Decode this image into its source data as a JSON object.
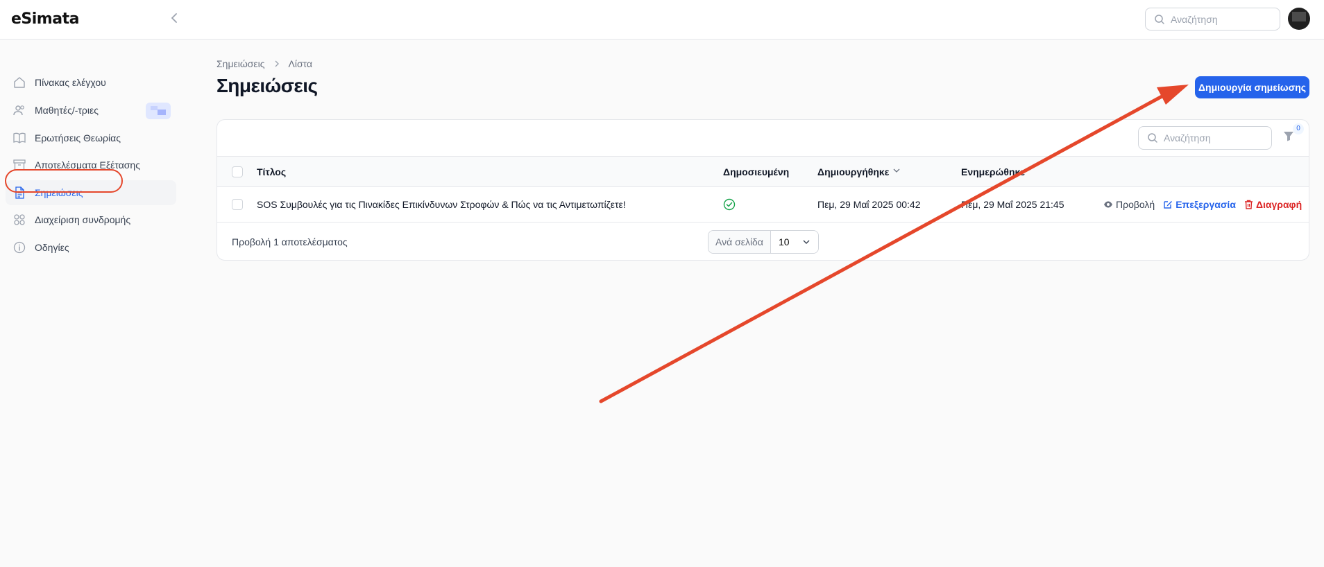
{
  "app": {
    "logo_text": "eSimata"
  },
  "topbar": {
    "search_placeholder": "Αναζήτηση"
  },
  "sidebar": {
    "items": [
      {
        "label": "Πίνακας ελέγχου",
        "icon": "home-icon"
      },
      {
        "label": "Μαθητές/-τριες",
        "icon": "users-icon"
      },
      {
        "label": "Ερωτήσεις Θεωρίας",
        "icon": "book-icon"
      },
      {
        "label": "Αποτελέσματα Εξέτασης",
        "icon": "archive-icon"
      },
      {
        "label": "Σημειώσεις",
        "icon": "document-icon",
        "active": true
      },
      {
        "label": "Διαχείριση συνδρομής",
        "icon": "grid-icon"
      },
      {
        "label": "Οδηγίες",
        "icon": "info-icon"
      }
    ]
  },
  "breadcrumb": {
    "items": [
      "Σημειώσεις",
      "Λίστα"
    ]
  },
  "page": {
    "title": "Σημειώσεις",
    "create_button": "Δημιουργία σημείωσης"
  },
  "table": {
    "search_placeholder": "Αναζήτηση",
    "filter_count": "0",
    "columns": [
      "Τίτλος",
      "Δημοσιευμένη",
      "Δημιουργήθηκε",
      "Ενημερώθηκε"
    ],
    "rows": [
      {
        "title": "SOS Συμβουλές για τις Πινακίδες Επικίνδυνων Στροφών & Πώς να τις Αντιμετωπίζετε!",
        "published": true,
        "created": "Πεμ, 29 Μαΐ 2025 00:42",
        "updated": "Πεμ, 29 Μαΐ 2025 21:45"
      }
    ],
    "actions": {
      "view": "Προβολή",
      "edit": "Επεξεργασία",
      "delete": "Διαγραφή"
    },
    "footer": {
      "results": "Προβολή 1 αποτελέσματος",
      "per_page_label": "Ανά σελίδα",
      "per_page_value": "10"
    }
  },
  "colors": {
    "accent": "#2563eb",
    "danger": "#dc2626",
    "annotation": "#e5472b",
    "success": "#16a34a"
  }
}
